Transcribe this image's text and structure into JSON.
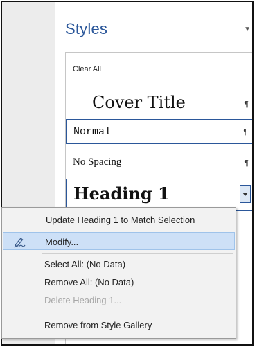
{
  "pane": {
    "title": "Styles",
    "clear_all": "Clear All",
    "items": [
      {
        "label": "Cover Title",
        "mark": "¶"
      },
      {
        "label": "Normal",
        "mark": "¶"
      },
      {
        "label": "No Spacing",
        "mark": "¶"
      },
      {
        "label": "Heading 1"
      }
    ]
  },
  "context_menu": {
    "items": [
      {
        "label": "Update Heading 1 to Match Selection",
        "enabled": true
      },
      {
        "label": "Modify...",
        "enabled": true,
        "highlighted": true,
        "icon": "modify-style-icon"
      },
      {
        "label": "Select All: (No Data)",
        "enabled": true
      },
      {
        "label": "Remove All: (No Data)",
        "enabled": true
      },
      {
        "label": "Delete Heading 1...",
        "enabled": false
      },
      {
        "label": "Remove from Style Gallery",
        "enabled": true
      }
    ]
  },
  "colors": {
    "accent": "#2b579a",
    "menu_highlight": "#cde0f7"
  }
}
